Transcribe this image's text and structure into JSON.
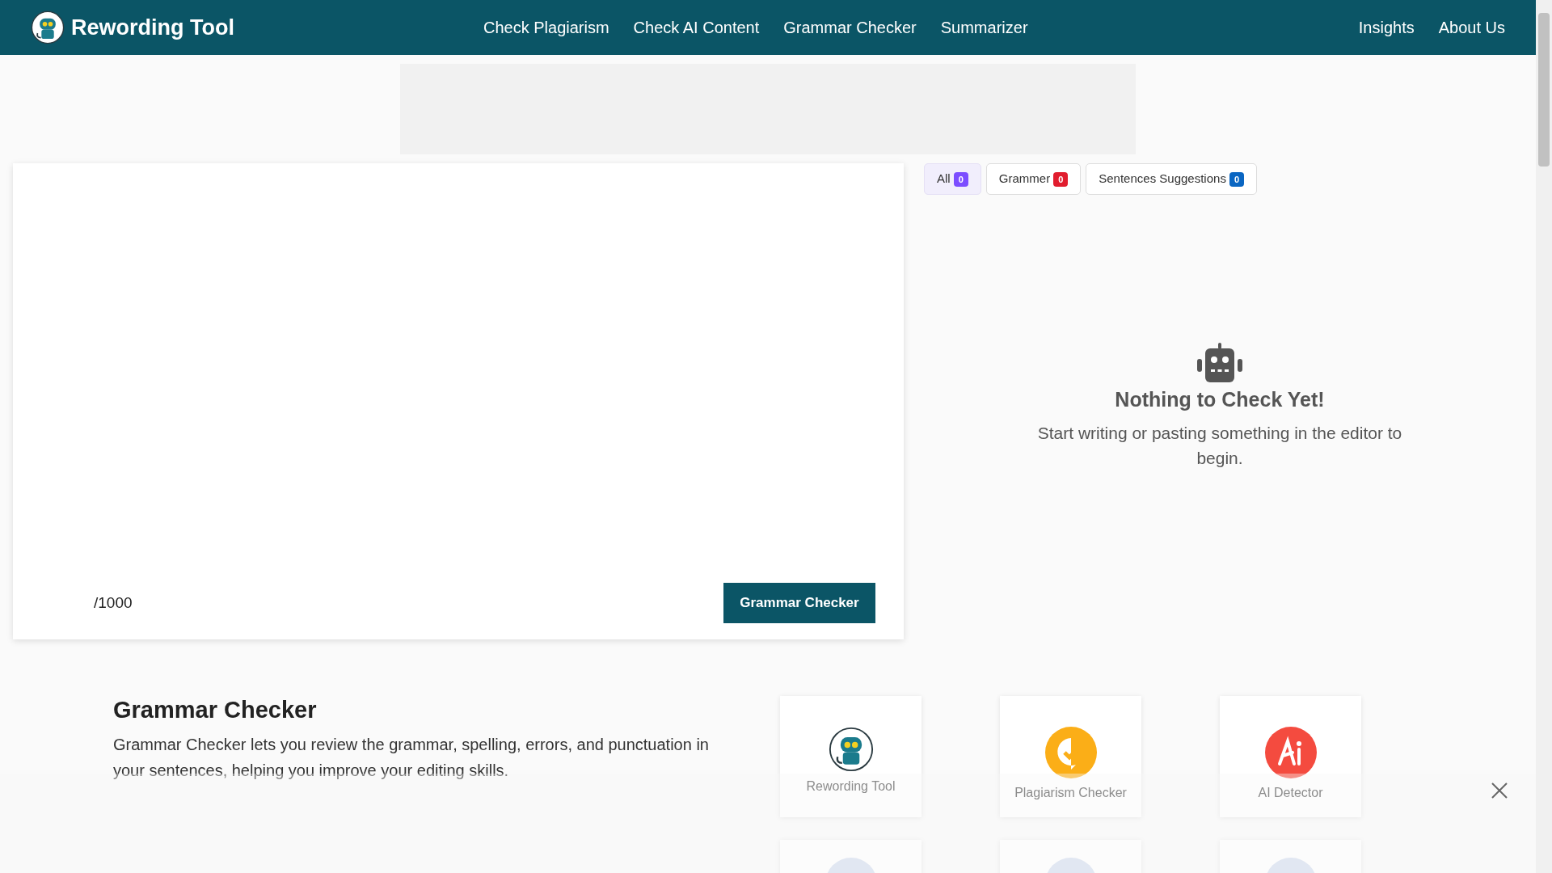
{
  "brand": {
    "name": "Rewording Tool"
  },
  "nav": {
    "center": [
      "Check Plagiarism",
      "Check AI Content",
      "Grammar Checker",
      "Summarizer"
    ],
    "right": [
      "Insights",
      "About Us"
    ]
  },
  "editor": {
    "counter": "/1000",
    "submit": "Grammar Checker"
  },
  "tabs": [
    {
      "label": "All",
      "count": "0",
      "selected": true,
      "color": "#7c4dff"
    },
    {
      "label": "Grammer",
      "count": "0",
      "selected": false,
      "color": "#e11d2e"
    },
    {
      "label": "Sentences Suggestions",
      "count": "0",
      "selected": false,
      "color": "#0a66c2"
    }
  ],
  "empty_state": {
    "title": "Nothing to Check Yet!",
    "message": "Start writing or pasting something in the editor to begin."
  },
  "about": {
    "title": "Grammar Checker",
    "text": "Grammar Checker lets you review the grammar, spelling, errors, and punctuation in your sentences, helping you improve your editing skills."
  },
  "tool_cards": [
    {
      "kind": "robot",
      "label": "Rewording Tool"
    },
    {
      "kind": "check",
      "label": "Plagiarism Checker"
    },
    {
      "kind": "ai",
      "label": "AI Detector"
    },
    {
      "kind": "faded"
    },
    {
      "kind": "faded"
    },
    {
      "kind": "faded"
    }
  ]
}
